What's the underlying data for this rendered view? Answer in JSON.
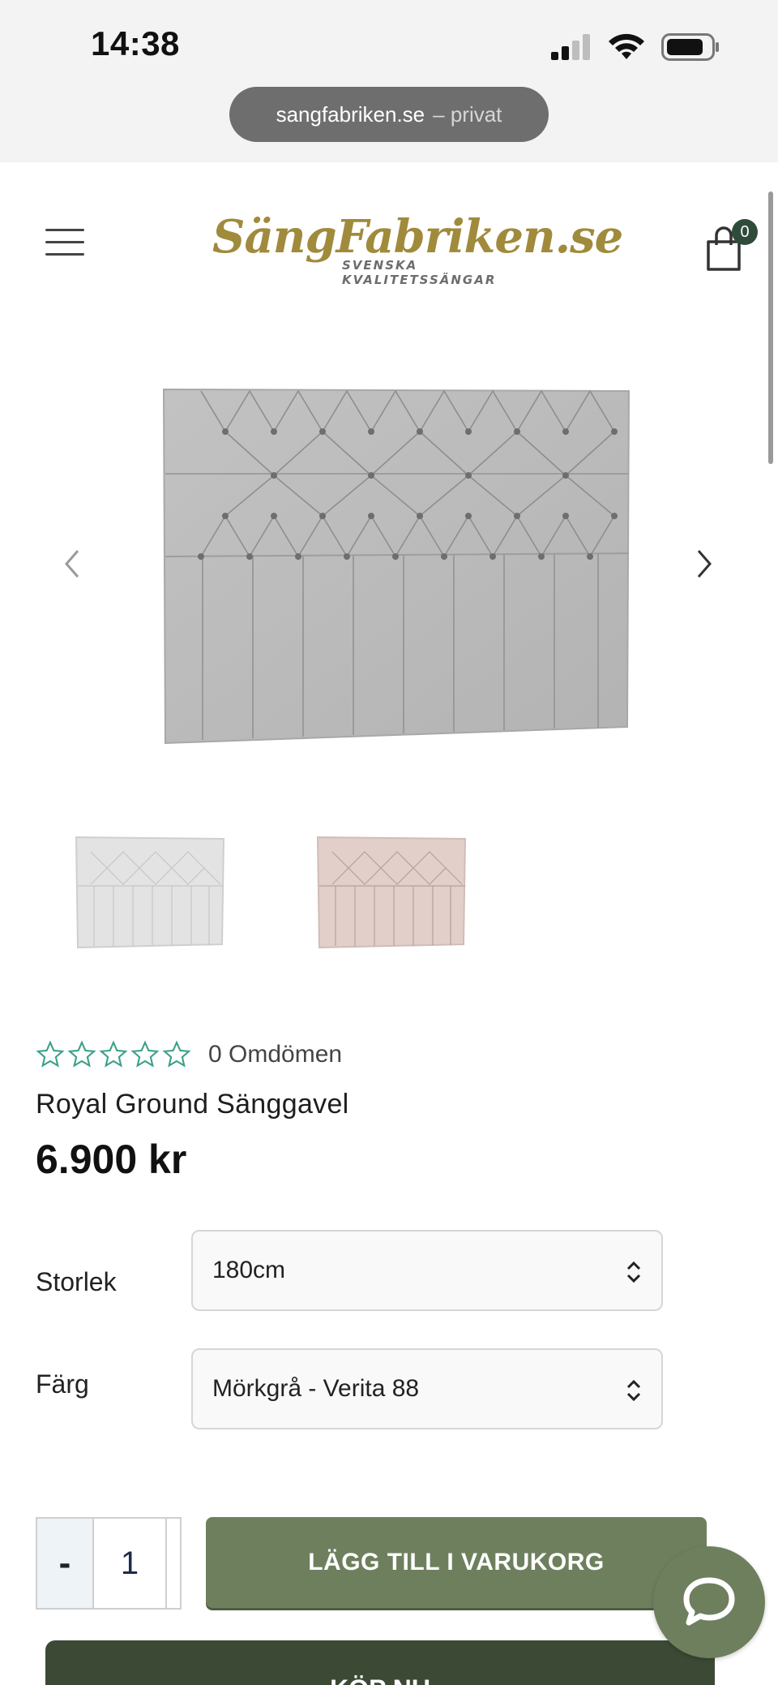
{
  "status_bar": {
    "time": "14:38",
    "url": "sangfabriken.se",
    "url_suffix": "– privat"
  },
  "header": {
    "logo_main": "SängFabriken.se",
    "logo_sub": "SVENSKA KVALITETSSÄNGAR",
    "cart_count": "0",
    "icons": [
      "menu-icon",
      "shopping-bag-icon"
    ]
  },
  "gallery": {
    "icons": [
      "chevron-left-icon",
      "chevron-right-icon"
    ],
    "thumbnail_colors": [
      "#e0e0e0",
      "#e2cfca"
    ],
    "main_color": "#b9b9b9"
  },
  "product": {
    "rating": 0,
    "reviews_label": "0 Omdömen",
    "title": "Royal Ground Sänggavel",
    "price": "6.900 kr"
  },
  "options": {
    "size_label": "Storlek",
    "size_value": "180cm",
    "color_label": "Färg",
    "color_value": "Mörkgrå - Verita 88"
  },
  "cart_actions": {
    "minus_label": "-",
    "quantity": "1",
    "add_to_cart_label": "LÄGG TILL I VARUKORG",
    "buy_now_label": "KÖP NU"
  },
  "colors": {
    "accent_green": "#6e7f5e",
    "dark_green": "#3c4a35",
    "logo_gold": "#a08a3c",
    "star_green": "#3aa08a"
  }
}
